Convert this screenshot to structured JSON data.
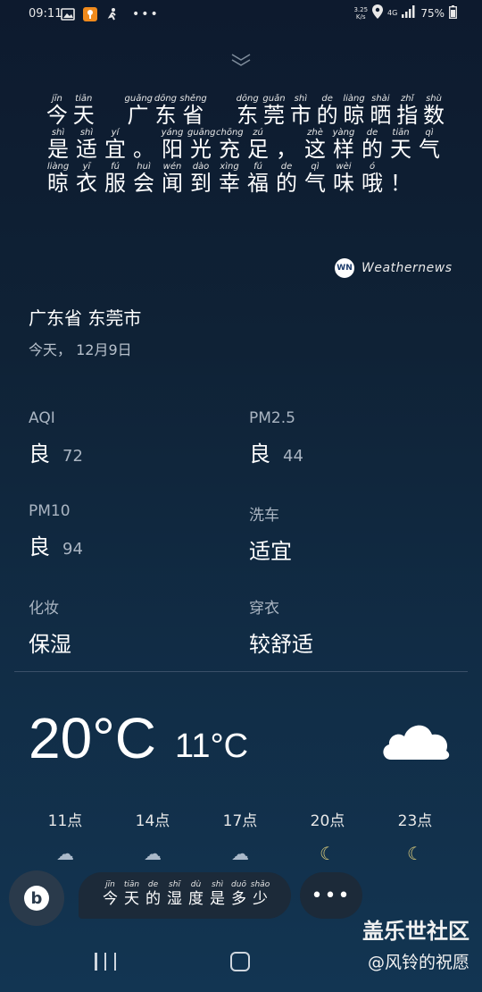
{
  "status_bar": {
    "time": "09:11",
    "speed_value": "3.25",
    "speed_unit": "K/s",
    "network": "4G",
    "battery": "75%"
  },
  "sentence": {
    "lines": [
      [
        {
          "py": "jīn",
          "hz": "今"
        },
        {
          "py": "tiān",
          "hz": "天"
        },
        {
          "py": "",
          "hz": " "
        },
        {
          "py": "guǎng",
          "hz": "广"
        },
        {
          "py": "dōng",
          "hz": "东"
        },
        {
          "py": "shěng",
          "hz": "省"
        },
        {
          "py": "",
          "hz": " "
        },
        {
          "py": "dōng",
          "hz": "东"
        },
        {
          "py": "guǎn",
          "hz": "莞"
        },
        {
          "py": "shì",
          "hz": "市"
        },
        {
          "py": "de",
          "hz": "的"
        },
        {
          "py": "liàng",
          "hz": "晾"
        },
        {
          "py": "shài",
          "hz": "晒"
        },
        {
          "py": "zhǐ",
          "hz": "指"
        },
        {
          "py": "shù",
          "hz": "数"
        }
      ],
      [
        {
          "py": "shì",
          "hz": "是"
        },
        {
          "py": "shì",
          "hz": "适"
        },
        {
          "py": "yí",
          "hz": "宜"
        },
        {
          "py": "",
          "hz": "。"
        },
        {
          "py": "yáng",
          "hz": "阳"
        },
        {
          "py": "guāng",
          "hz": "光"
        },
        {
          "py": "chōng",
          "hz": "充"
        },
        {
          "py": "zú",
          "hz": "足"
        },
        {
          "py": "",
          "hz": "，"
        },
        {
          "py": "zhè",
          "hz": "这"
        },
        {
          "py": "yàng",
          "hz": "样"
        },
        {
          "py": "de",
          "hz": "的"
        },
        {
          "py": "tiān",
          "hz": "天"
        },
        {
          "py": "qì",
          "hz": "气"
        }
      ],
      [
        {
          "py": "liàng",
          "hz": "晾"
        },
        {
          "py": "yī",
          "hz": "衣"
        },
        {
          "py": "fú",
          "hz": "服"
        },
        {
          "py": "huì",
          "hz": "会"
        },
        {
          "py": "wén",
          "hz": "闻"
        },
        {
          "py": "dào",
          "hz": "到"
        },
        {
          "py": "xìng",
          "hz": "幸"
        },
        {
          "py": "fú",
          "hz": "福"
        },
        {
          "py": "de",
          "hz": "的"
        },
        {
          "py": "qì",
          "hz": "气"
        },
        {
          "py": "wèi",
          "hz": "味"
        },
        {
          "py": "ó",
          "hz": "哦"
        },
        {
          "py": "",
          "hz": "！"
        }
      ]
    ]
  },
  "brand": {
    "logo": "WN",
    "name": "Weathernews"
  },
  "location": "广东省 东莞市",
  "date": "今天，  12月9日",
  "indices": [
    {
      "label": "AQI",
      "value": "良",
      "num": "72"
    },
    {
      "label": "PM2.5",
      "value": "良",
      "num": "44"
    },
    {
      "label": "PM10",
      "value": "良",
      "num": "94"
    },
    {
      "label": "洗车",
      "value": "适宜",
      "num": ""
    },
    {
      "label": "化妆",
      "value": "保湿",
      "num": ""
    },
    {
      "label": "穿衣",
      "value": "较舒适",
      "num": ""
    }
  ],
  "temperature": {
    "high": "20°C",
    "low": "11°C",
    "icon": "cloud-icon"
  },
  "hourly": [
    {
      "time": "11点",
      "icon": "partly-sunny-icon"
    },
    {
      "time": "14点",
      "icon": "partly-sunny-icon"
    },
    {
      "time": "17点",
      "icon": "partly-sunny-icon"
    },
    {
      "time": "20点",
      "icon": "moon-icon"
    },
    {
      "time": "23点",
      "icon": "moon-icon"
    }
  ],
  "bixby": {
    "query": [
      {
        "py": "jīn",
        "hz": "今"
      },
      {
        "py": "tiān",
        "hz": "天"
      },
      {
        "py": "de",
        "hz": "的"
      },
      {
        "py": "shī",
        "hz": "湿"
      },
      {
        "py": "dù",
        "hz": "度"
      },
      {
        "py": "shì",
        "hz": "是"
      },
      {
        "py": "duō",
        "hz": "多"
      },
      {
        "py": "shǎo",
        "hz": "少"
      }
    ],
    "more_label": "•••"
  },
  "watermark": {
    "line1": "盖乐世社区",
    "line2": "@风铃的祝愿"
  }
}
